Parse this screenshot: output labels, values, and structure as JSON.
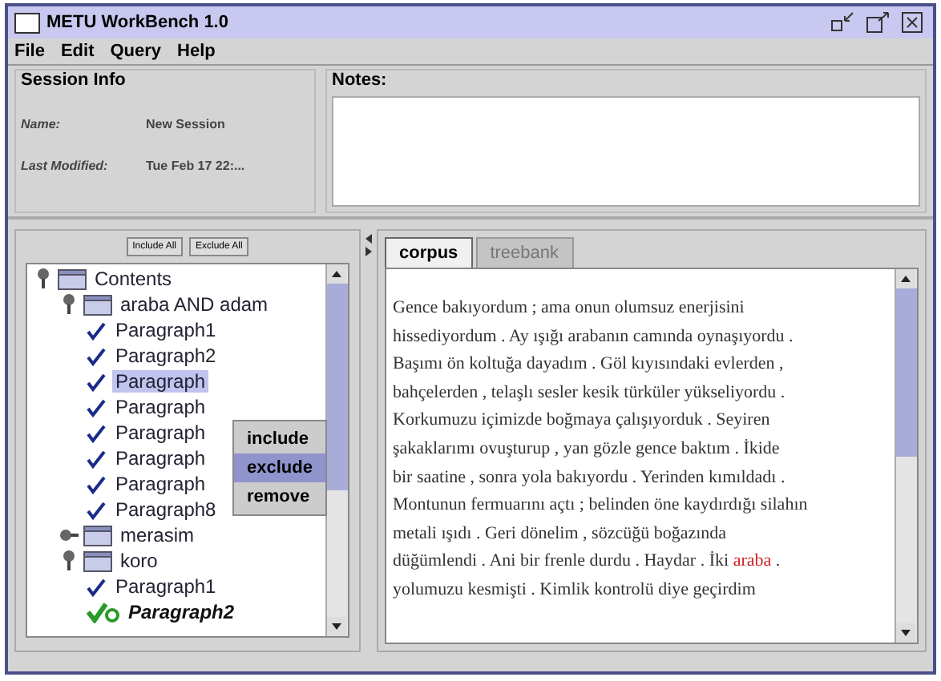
{
  "window": {
    "title": "METU WorkBench 1.0"
  },
  "menu": [
    "File",
    "Edit",
    "Query",
    "Help"
  ],
  "session_info": {
    "title": "Session Info",
    "fields": [
      {
        "label": "Name:",
        "value": "New Session"
      },
      {
        "label": "Last Modified:",
        "value": "Tue Feb 17 22:..."
      }
    ]
  },
  "notes": {
    "title": "Notes:"
  },
  "tree_buttons": [
    "Include All",
    "Exclude All"
  ],
  "tree": [
    {
      "label": "Contents",
      "kind": "folder",
      "expanded": true,
      "children": [
        {
          "label": "araba AND adam",
          "kind": "folder",
          "expanded": true,
          "children": [
            {
              "label": "Paragraph1",
              "kind": "check",
              "selected": false
            },
            {
              "label": "Paragraph2",
              "kind": "check",
              "selected": false
            },
            {
              "label": "Paragraph",
              "kind": "check",
              "selected": true
            },
            {
              "label": "Paragraph",
              "kind": "check",
              "selected": false
            },
            {
              "label": "Paragraph",
              "kind": "check",
              "selected": false
            },
            {
              "label": "Paragraph",
              "kind": "check",
              "selected": false
            },
            {
              "label": "Paragraph",
              "kind": "check",
              "selected": false
            },
            {
              "label": "Paragraph8",
              "kind": "check",
              "selected": false
            }
          ]
        },
        {
          "label": "merasim",
          "kind": "folder",
          "expanded": false
        },
        {
          "label": "koro",
          "kind": "folder",
          "expanded": true,
          "children": [
            {
              "label": "Paragraph1",
              "kind": "check",
              "selected": false
            },
            {
              "label": "Paragraph2",
              "kind": "active",
              "selected": false
            }
          ]
        }
      ]
    }
  ],
  "context_menu": [
    {
      "label": "include",
      "selected": false
    },
    {
      "label": "exclude",
      "selected": true
    },
    {
      "label": "remove",
      "selected": false
    }
  ],
  "tabs": [
    {
      "label": "corpus",
      "selected": true,
      "disabled": false
    },
    {
      "label": "treebank",
      "selected": false,
      "disabled": true
    }
  ],
  "text_lines": [
    [
      {
        "text": "Gence bakıyordum ; ama onun olumsuz enerjisini",
        "highlight": false
      }
    ],
    [
      {
        "text": "hissediyordum . Ay ışığı arabanın camında oynaşıyordu .",
        "highlight": false
      }
    ],
    [
      {
        "text": "Başımı ön koltuğa dayadım . Göl kıyısındaki evlerden ,",
        "highlight": false
      }
    ],
    [
      {
        "text": "bahçelerden , telaşlı sesler kesik türküler yükseliyordu .",
        "highlight": false
      }
    ],
    [
      {
        "text": "Korkumuzu içimizde boğmaya çalışıyorduk . Seyiren",
        "highlight": false
      }
    ],
    [
      {
        "text": "şakaklarımı ovuşturup , yan gözle gence baktım . İkide",
        "highlight": false
      }
    ],
    [
      {
        "text": "bir saatine , sonra yola bakıyordu . Yerinden kımıldadı .",
        "highlight": false
      }
    ],
    [
      {
        "text": "Montunun fermuarını açtı ; belinden öne kaydırdığı silahın",
        "highlight": false
      }
    ],
    [
      {
        "text": "metali ışıdı . Geri dönelim , sözcüğü boğazında",
        "highlight": false
      }
    ],
    [
      {
        "text": "düğümlendi . Ani bir frenle durdu . Haydar . İki ",
        "highlight": false
      },
      {
        "text": "araba",
        "highlight": true
      },
      {
        "text": " .",
        "highlight": false
      }
    ],
    [
      {
        "text": "yolumuzu kesmişti . Kimlik kontrolü diye geçirdim",
        "highlight": false
      }
    ]
  ]
}
